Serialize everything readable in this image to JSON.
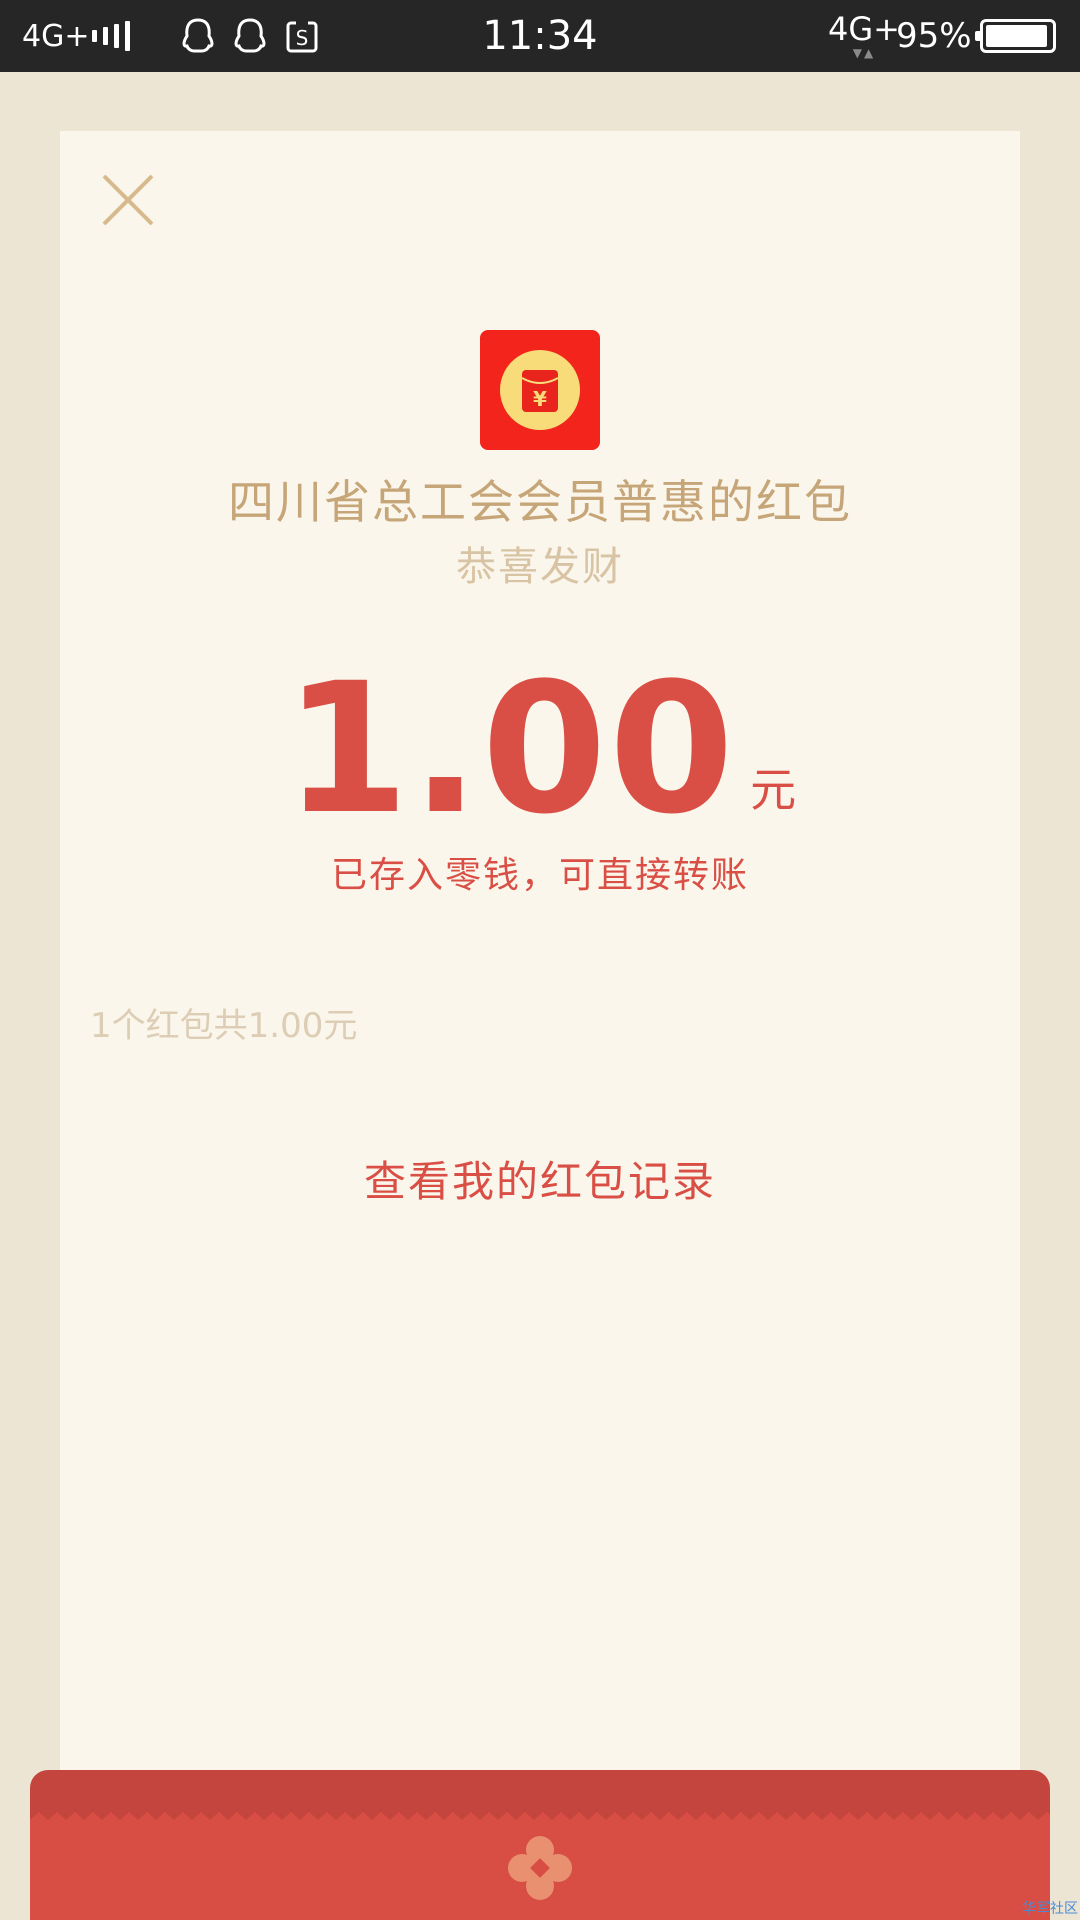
{
  "status_bar": {
    "network_left": "4G+",
    "time": "11:34",
    "network_right": "4G+",
    "network_right_arrows": "▼▲",
    "battery_percent": "95%",
    "battery_level": 0.95
  },
  "card": {
    "title": "四川省总工会会员普惠的红包",
    "greeting": "恭喜发财",
    "amount": "1.00",
    "amount_unit": "元",
    "saved_note": "已存入零钱，可直接转账",
    "summary": "1个红包共1.00元",
    "record_link": "查看我的红包记录",
    "icon_glyph": "¥"
  },
  "watermark": "华军社区",
  "colors": {
    "background": "#ede5d3",
    "card": "#fbf6ec",
    "accent_red": "#d94f45",
    "gold_text": "#c6a678",
    "light_gold": "#d8c4a4",
    "icon_red": "#f2241c",
    "icon_yellow": "#f8dc7a",
    "status_bar": "#262626"
  },
  "icons": [
    "signal-icon",
    "qq-icon",
    "qq-icon",
    "app-notification-icon",
    "battery-icon",
    "close-icon",
    "red-packet-icon",
    "flower-emblem-icon"
  ]
}
